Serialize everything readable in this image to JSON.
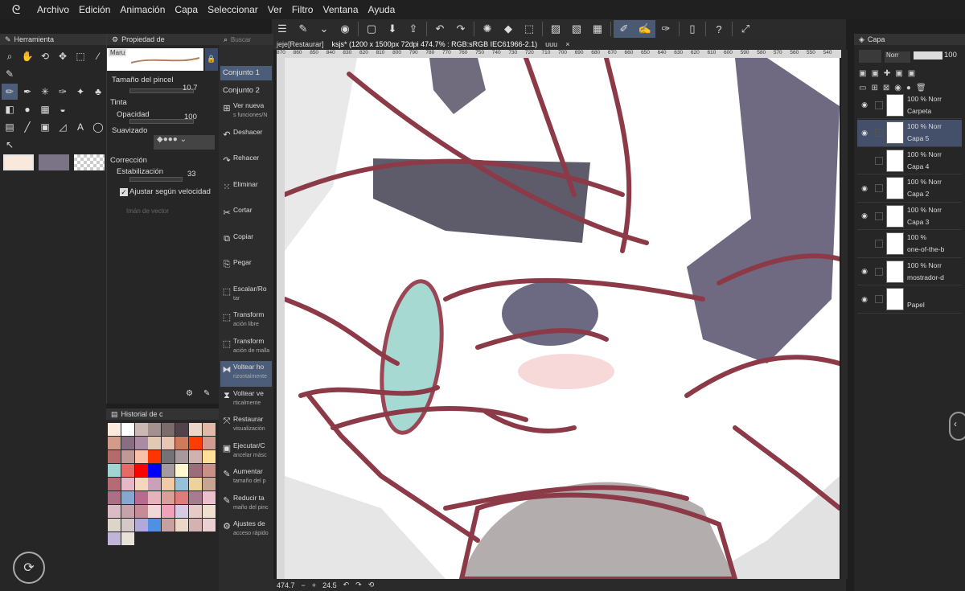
{
  "menu": [
    "Archivo",
    "Edición",
    "Animación",
    "Capa",
    "Seleccionar",
    "Ver",
    "Filtro",
    "Ventana",
    "Ayuda"
  ],
  "panels": {
    "tool_tab": "Herramienta",
    "subtool_tab": "Propiedad de",
    "search_placeholder": "Buscar",
    "brush_name": "Maru",
    "brush_size_label": "Tamaño del pincel",
    "brush_size_value": "10.7",
    "tint_label": "Tinta",
    "opacity_label": "Opacidad",
    "opacity_value": "100",
    "smoothing_label": "Suavizado",
    "correction_label": "Corrección",
    "stabilization_label": "Estabilización",
    "stabilization_value": "33",
    "adjust_speed_label": "Ajustar según velocidad",
    "vector_magnet_label": "Imán de vector",
    "history_tab": "Historial de c"
  },
  "sets": [
    "Conjunto 1",
    "Conjunto 2"
  ],
  "commands": [
    {
      "icon": "⊞",
      "l1": "Ver nueva",
      "l2": "s funciones/N"
    },
    {
      "icon": "↶",
      "l1": "Deshacer",
      "l2": ""
    },
    {
      "icon": "↷",
      "l1": "Rehacer",
      "l2": ""
    },
    {
      "icon": "⁙",
      "l1": "Eliminar",
      "l2": ""
    },
    {
      "icon": "✂",
      "l1": "Cortar",
      "l2": ""
    },
    {
      "icon": "⧉",
      "l1": "Copiar",
      "l2": ""
    },
    {
      "icon": "⎘",
      "l1": "Pegar",
      "l2": ""
    },
    {
      "icon": "⬚",
      "l1": "Escalar/Ro",
      "l2": "tar"
    },
    {
      "icon": "⬚",
      "l1": "Transform",
      "l2": "ación libre"
    },
    {
      "icon": "⬚",
      "l1": "Transform",
      "l2": "ación de malla"
    },
    {
      "icon": "⧓",
      "l1": "Voltear ho",
      "l2": "rizontalmente"
    },
    {
      "icon": "⧗",
      "l1": "Voltear ve",
      "l2": "rticalmente"
    },
    {
      "icon": "⤧",
      "l1": "Restaurar",
      "l2": "visualización"
    },
    {
      "icon": "▣",
      "l1": "Ejecutar/C",
      "l2": "ancelar másc"
    },
    {
      "icon": "✎",
      "l1": "Aumentar",
      "l2": "tamaño del p"
    },
    {
      "icon": "✎",
      "l1": "Reducir ta",
      "l2": "maño del pinc"
    },
    {
      "icon": "⚙",
      "l1": "Ajustes de",
      "l2": "acceso rápido"
    }
  ],
  "tabs": [
    "jeje[Restaurar]",
    "ksjs* (1200 x 1500px 72dpi 474.7% : RGB:sRGB IEC61966-2.1)",
    "uuu"
  ],
  "ruler": [
    "870",
    "860",
    "850",
    "840",
    "830",
    "820",
    "810",
    "800",
    "790",
    "780",
    "770",
    "760",
    "750",
    "740",
    "730",
    "720",
    "710",
    "700",
    "690",
    "680",
    "670",
    "660",
    "650",
    "640",
    "630",
    "620",
    "610",
    "600",
    "590",
    "580",
    "570",
    "560",
    "550",
    "540"
  ],
  "status": {
    "zoom": "474.7",
    "angle": "24.5"
  },
  "layer_panel": {
    "title": "Capa",
    "blend": "Norr",
    "opacity": "100"
  },
  "layers": [
    {
      "pct": "100 %",
      "mode": "Norr",
      "name": "Carpeta",
      "visible": true
    },
    {
      "pct": "100 %",
      "mode": "Norr",
      "name": "Capa 5",
      "visible": true
    },
    {
      "pct": "100 %",
      "mode": "Norr",
      "name": "Capa 4",
      "visible": false
    },
    {
      "pct": "100 %",
      "mode": "Norr",
      "name": "Capa 2",
      "visible": true
    },
    {
      "pct": "100 %",
      "mode": "Norr",
      "name": "Capa 3",
      "visible": true
    },
    {
      "pct": "100 %",
      "mode": "",
      "name": "one-of-the-b",
      "visible": false
    },
    {
      "pct": "100 %",
      "mode": "Norr",
      "name": "mostrador-d",
      "visible": true
    },
    {
      "pct": "",
      "mode": "",
      "name": "Papel",
      "visible": true
    }
  ],
  "colors": {
    "accent": "#4b5d78",
    "line": "#8c3a48",
    "main": "#f9e9dd",
    "sub": "#7b7486"
  }
}
